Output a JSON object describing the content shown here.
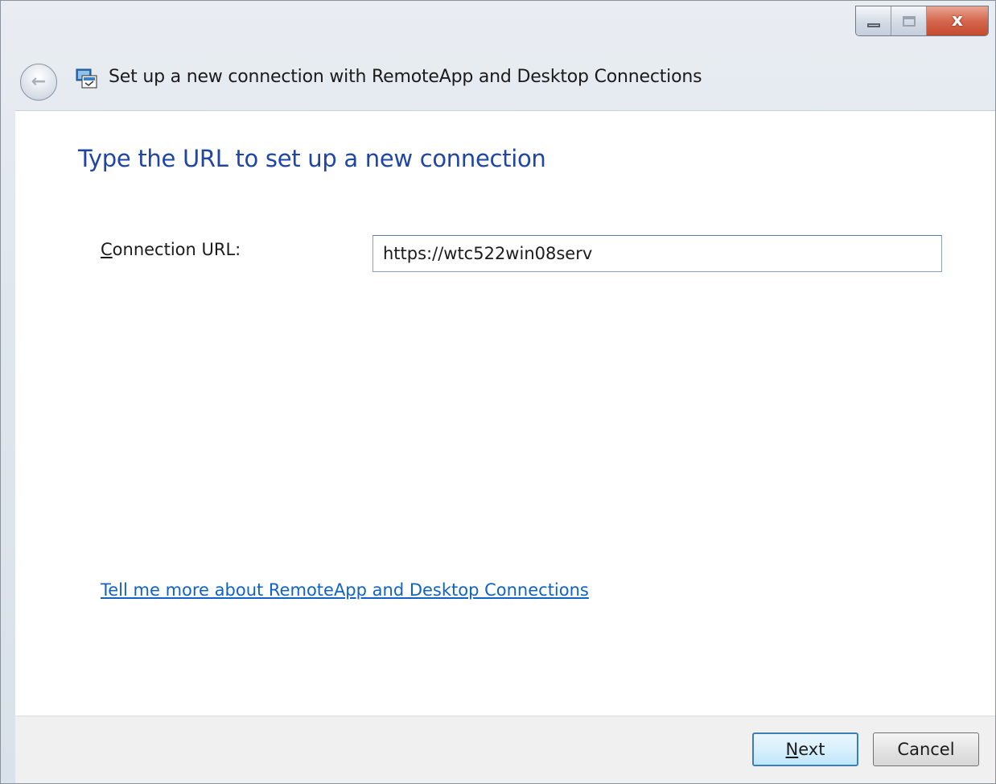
{
  "window": {
    "caption_buttons": [
      {
        "name": "minimize",
        "icon": "minimize-icon"
      },
      {
        "name": "maximize",
        "icon": "maximize-icon"
      },
      {
        "name": "close",
        "icon": "close-icon",
        "glyph": "x"
      }
    ]
  },
  "nav": {
    "back_icon": "back-arrow-icon",
    "back_glyph": "←",
    "app_icon": "remoteapp-icon",
    "title": "Set up a new connection with RemoteApp and Desktop Connections"
  },
  "main": {
    "heading": "Type the URL to set up a new connection",
    "url_label": {
      "accel": "C",
      "rest": "onnection URL:"
    },
    "url_value": "https://wtc522win08serv",
    "help_link": "Tell me more about RemoteApp and Desktop Connections"
  },
  "footer": {
    "next": {
      "accel": "N",
      "rest": "ext"
    },
    "cancel": "Cancel"
  },
  "colors": {
    "heading": "#1f45a8",
    "link": "#0f63c7",
    "close_button": "#c44a2f"
  }
}
